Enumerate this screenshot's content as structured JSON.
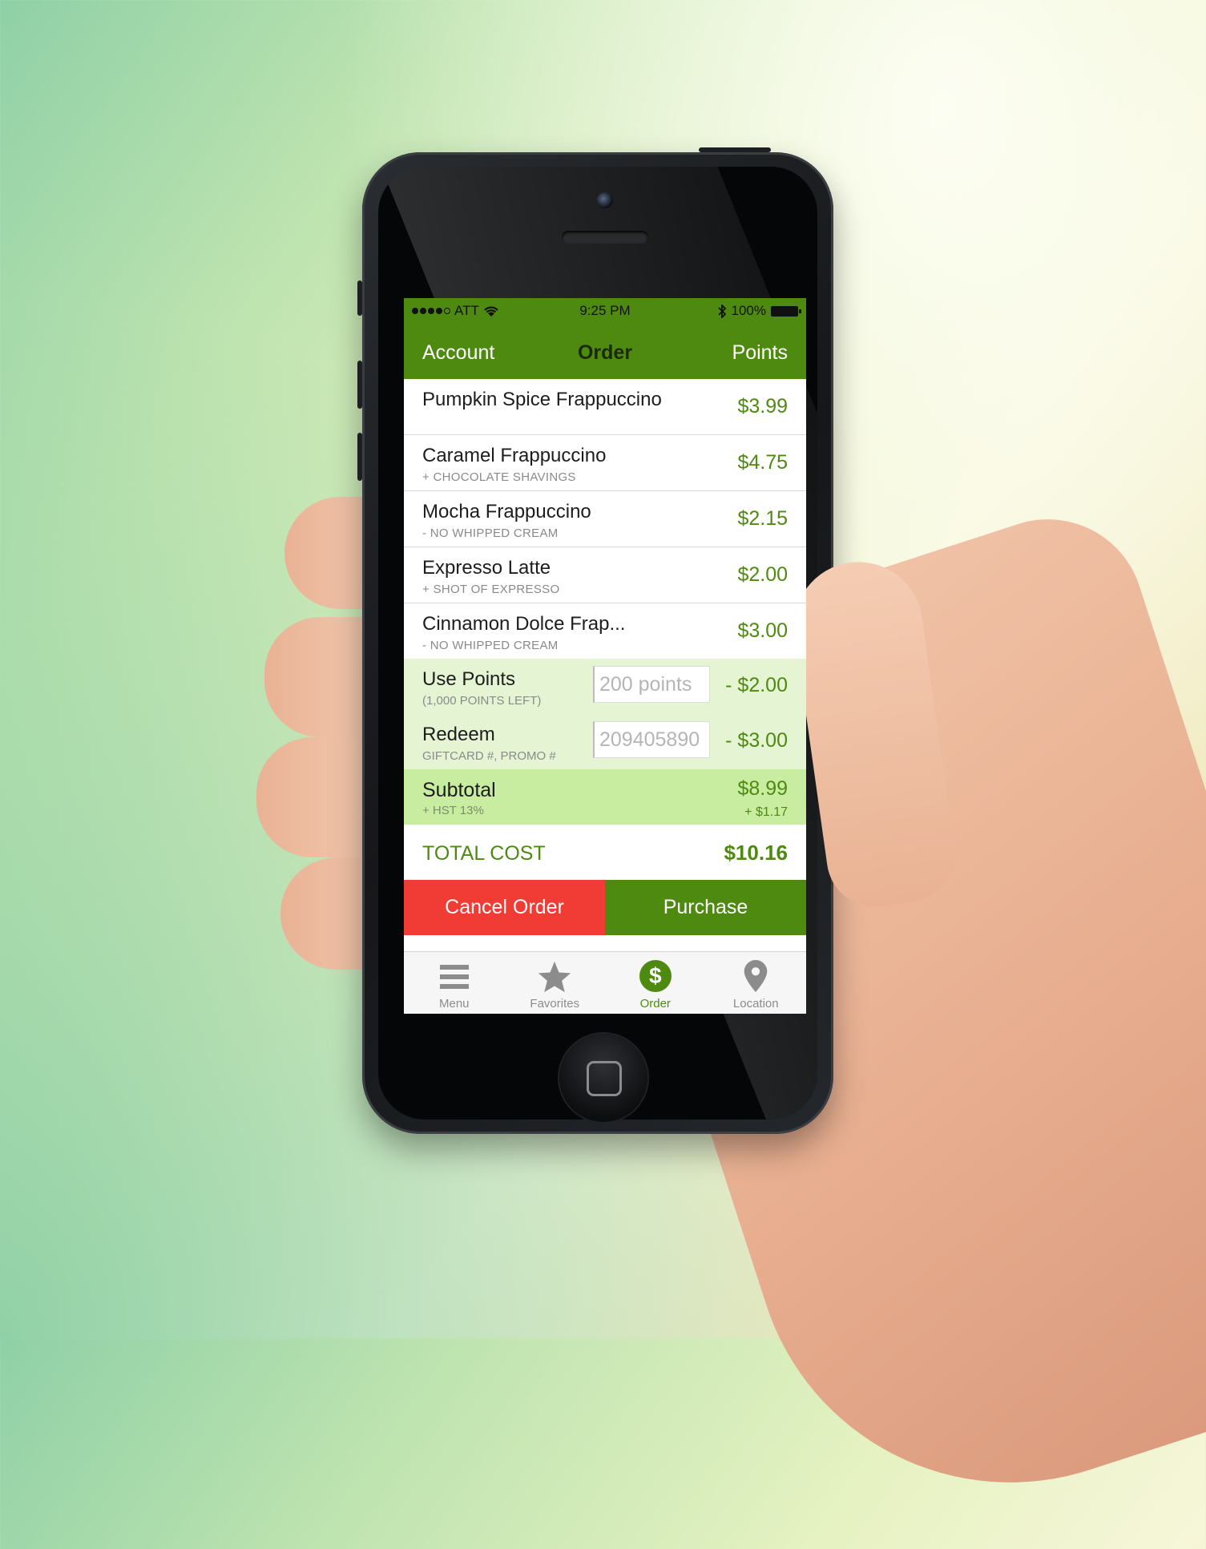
{
  "status_bar": {
    "carrier": "ATT",
    "time": "9:25 PM",
    "battery": "100%"
  },
  "nav": {
    "left": "Account",
    "title": "Order",
    "right": "Points"
  },
  "items": [
    {
      "name": "Pumpkin Spice Frappuccino",
      "modifier": "",
      "price": "$3.99"
    },
    {
      "name": "Caramel Frappuccino",
      "modifier": "+ CHOCOLATE SHAVINGS",
      "price": "$4.75"
    },
    {
      "name": "Mocha Frappuccino",
      "modifier": "- NO WHIPPED CREAM",
      "price": "$2.15"
    },
    {
      "name": "Expresso Latte",
      "modifier": "+ SHOT OF EXPRESSO",
      "price": "$2.00"
    },
    {
      "name": "Cinnamon Dolce Frap...",
      "modifier": "- NO WHIPPED CREAM",
      "price": "$3.00"
    }
  ],
  "points": {
    "label": "Use Points",
    "sub": "(1,000 POINTS LEFT)",
    "placeholder": "200 points",
    "discount": "- $2.00"
  },
  "redeem": {
    "label": "Redeem",
    "sub": "GIFTCARD #, PROMO #",
    "placeholder": "209405890",
    "discount": "- $3.00"
  },
  "subtotal": {
    "label": "Subtotal",
    "sub": "+ HST 13%",
    "amount": "$8.99",
    "tax": "+ $1.17"
  },
  "total": {
    "label": "TOTAL COST",
    "amount": "$10.16"
  },
  "actions": {
    "cancel": "Cancel Order",
    "purchase": "Purchase"
  },
  "tabs": [
    {
      "label": "Menu",
      "icon": "menu-icon"
    },
    {
      "label": "Favorites",
      "icon": "star-icon"
    },
    {
      "label": "Order",
      "icon": "dollar-icon"
    },
    {
      "label": "Location",
      "icon": "location-pin-icon"
    }
  ],
  "colors": {
    "brand_green": "#4f8a10",
    "cancel_red": "#f03c34",
    "promo_bg": "#e5f5d3",
    "subtotal_bg": "#c8eca0"
  }
}
